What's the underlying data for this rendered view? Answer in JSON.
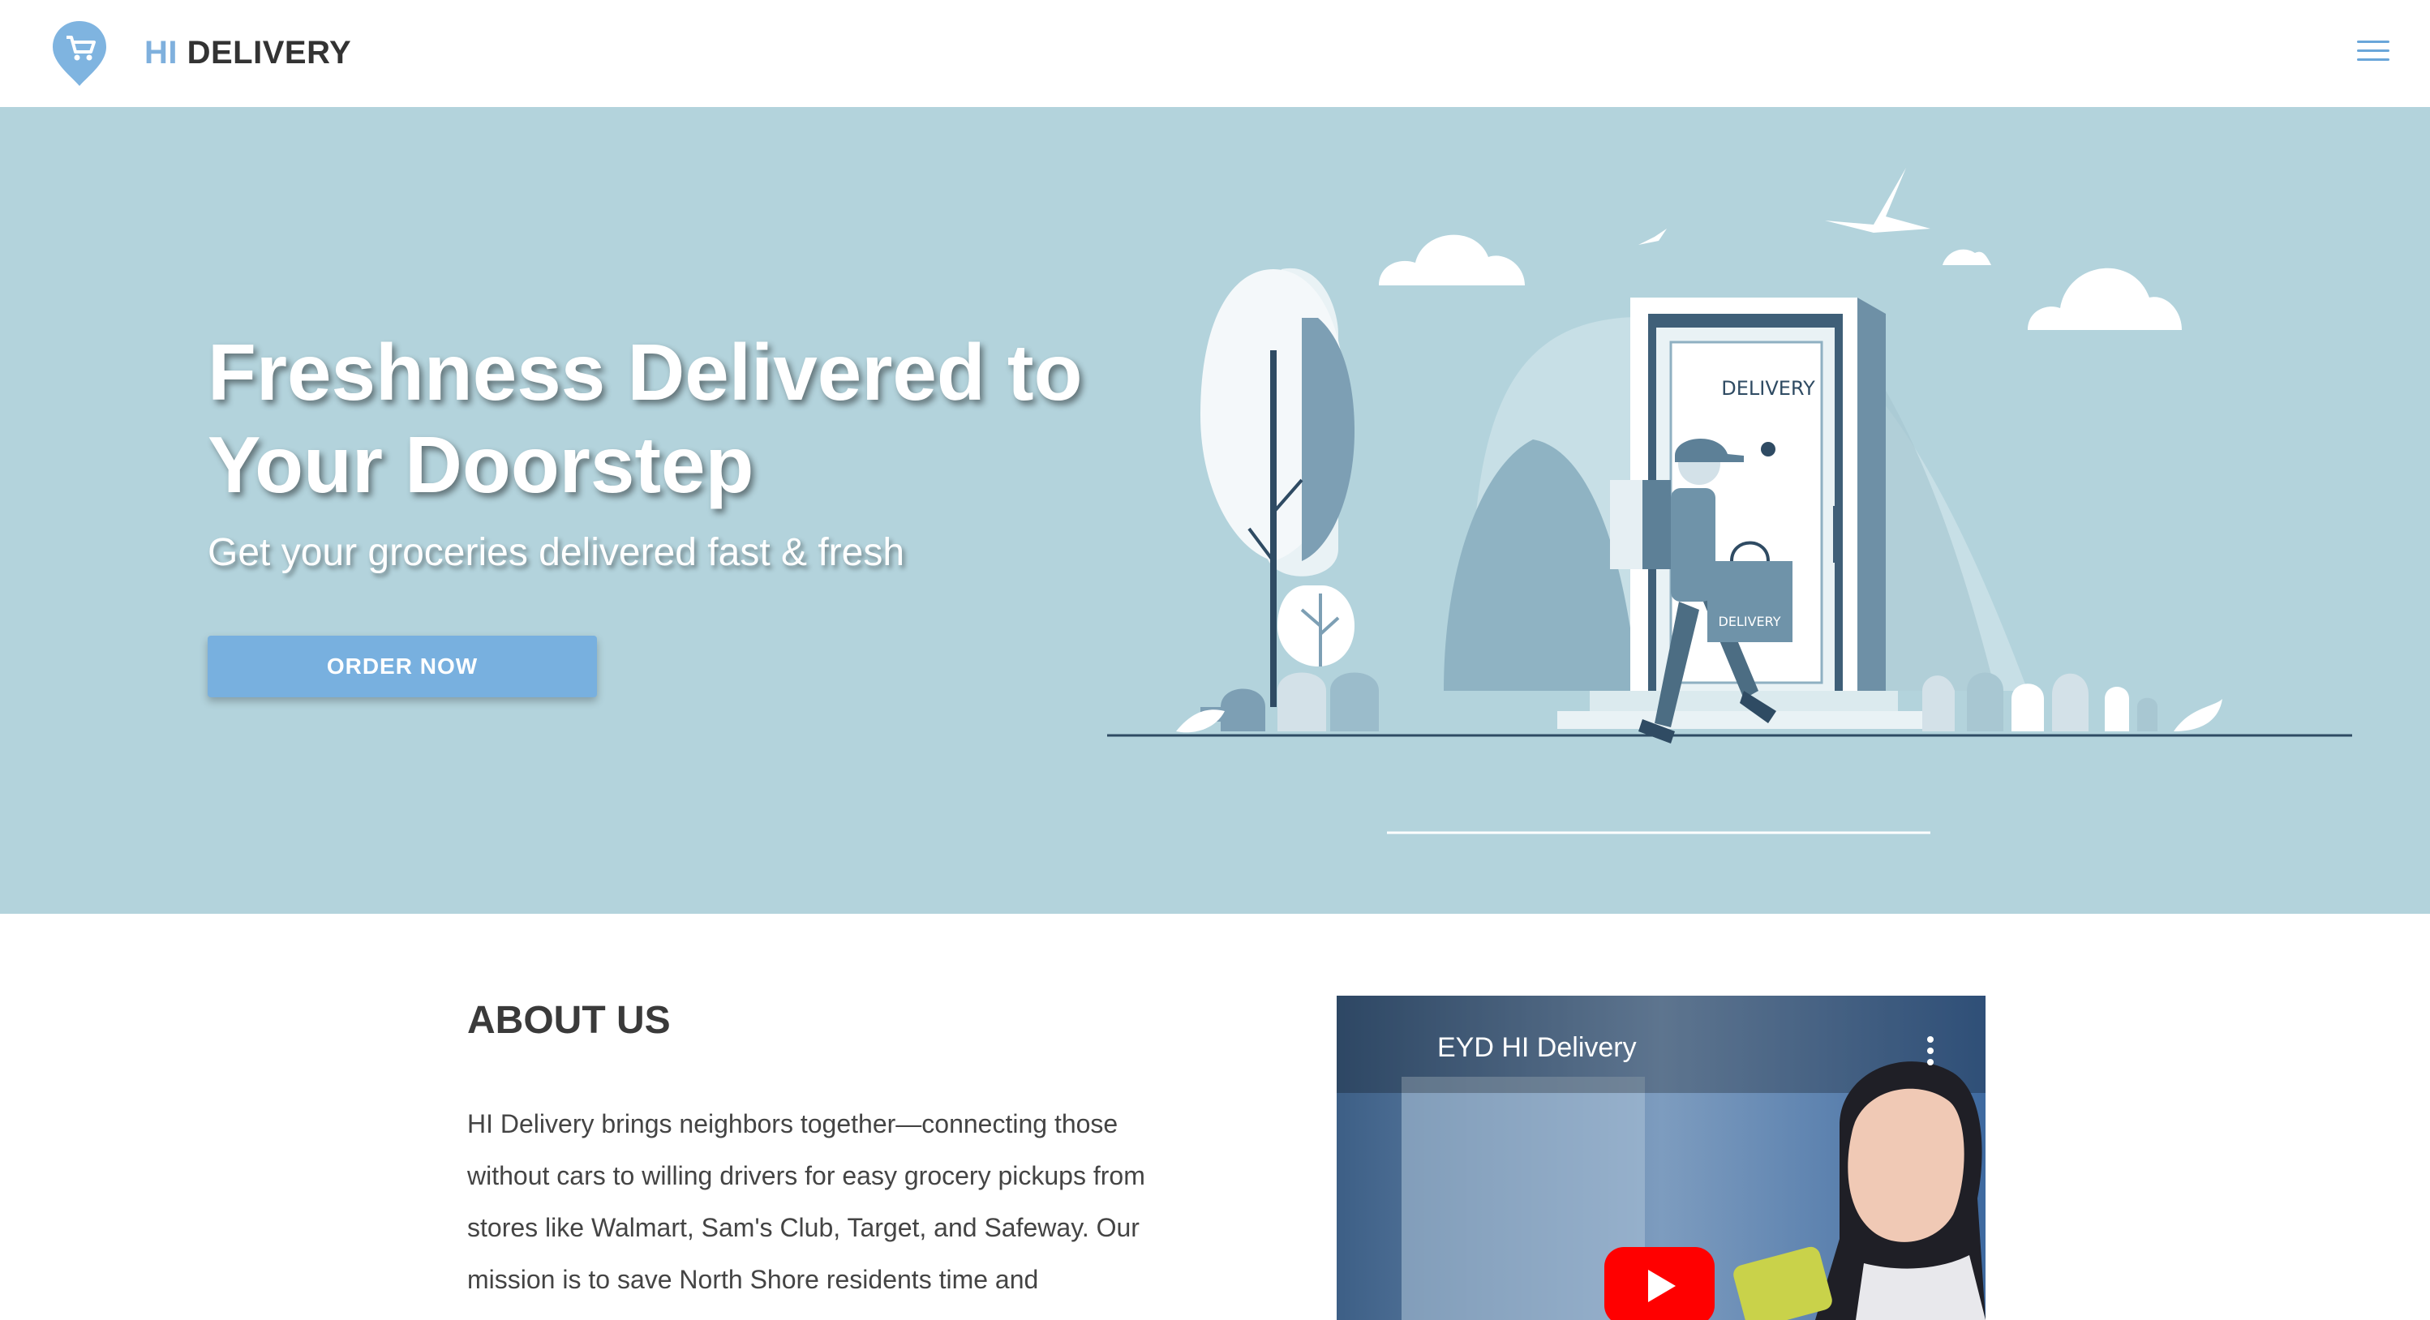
{
  "header": {
    "brand_hi": "HI",
    "brand_rest": " DELIVERY",
    "logo_icon": "shopping-cart-pin-icon",
    "menu_icon": "hamburger-menu-icon"
  },
  "hero": {
    "title": "Freshness Delivered to Your Doorstep",
    "subtitle": "Get your groceries delivered fast & fresh",
    "cta_label": "ORDER NOW",
    "door_sign": "DELIVERY",
    "bag_label": "DELIVERY"
  },
  "about": {
    "title": "ABOUT US",
    "text": "HI Delivery brings neighbors together—connecting those without cars to willing drivers for easy grocery pickups from stores like Walmart, Sam's Club, Target, and Safeway. Our mission is to save North Shore residents time and"
  },
  "video": {
    "title": "EYD HI Delivery",
    "play_icon": "youtube-play-icon",
    "menu_icon": "more-vertical-icon"
  },
  "colors": {
    "accent": "#78b0df",
    "brand_hi": "#7fb0dd",
    "hero_bg": "#b3d3dc",
    "text": "#333333"
  }
}
